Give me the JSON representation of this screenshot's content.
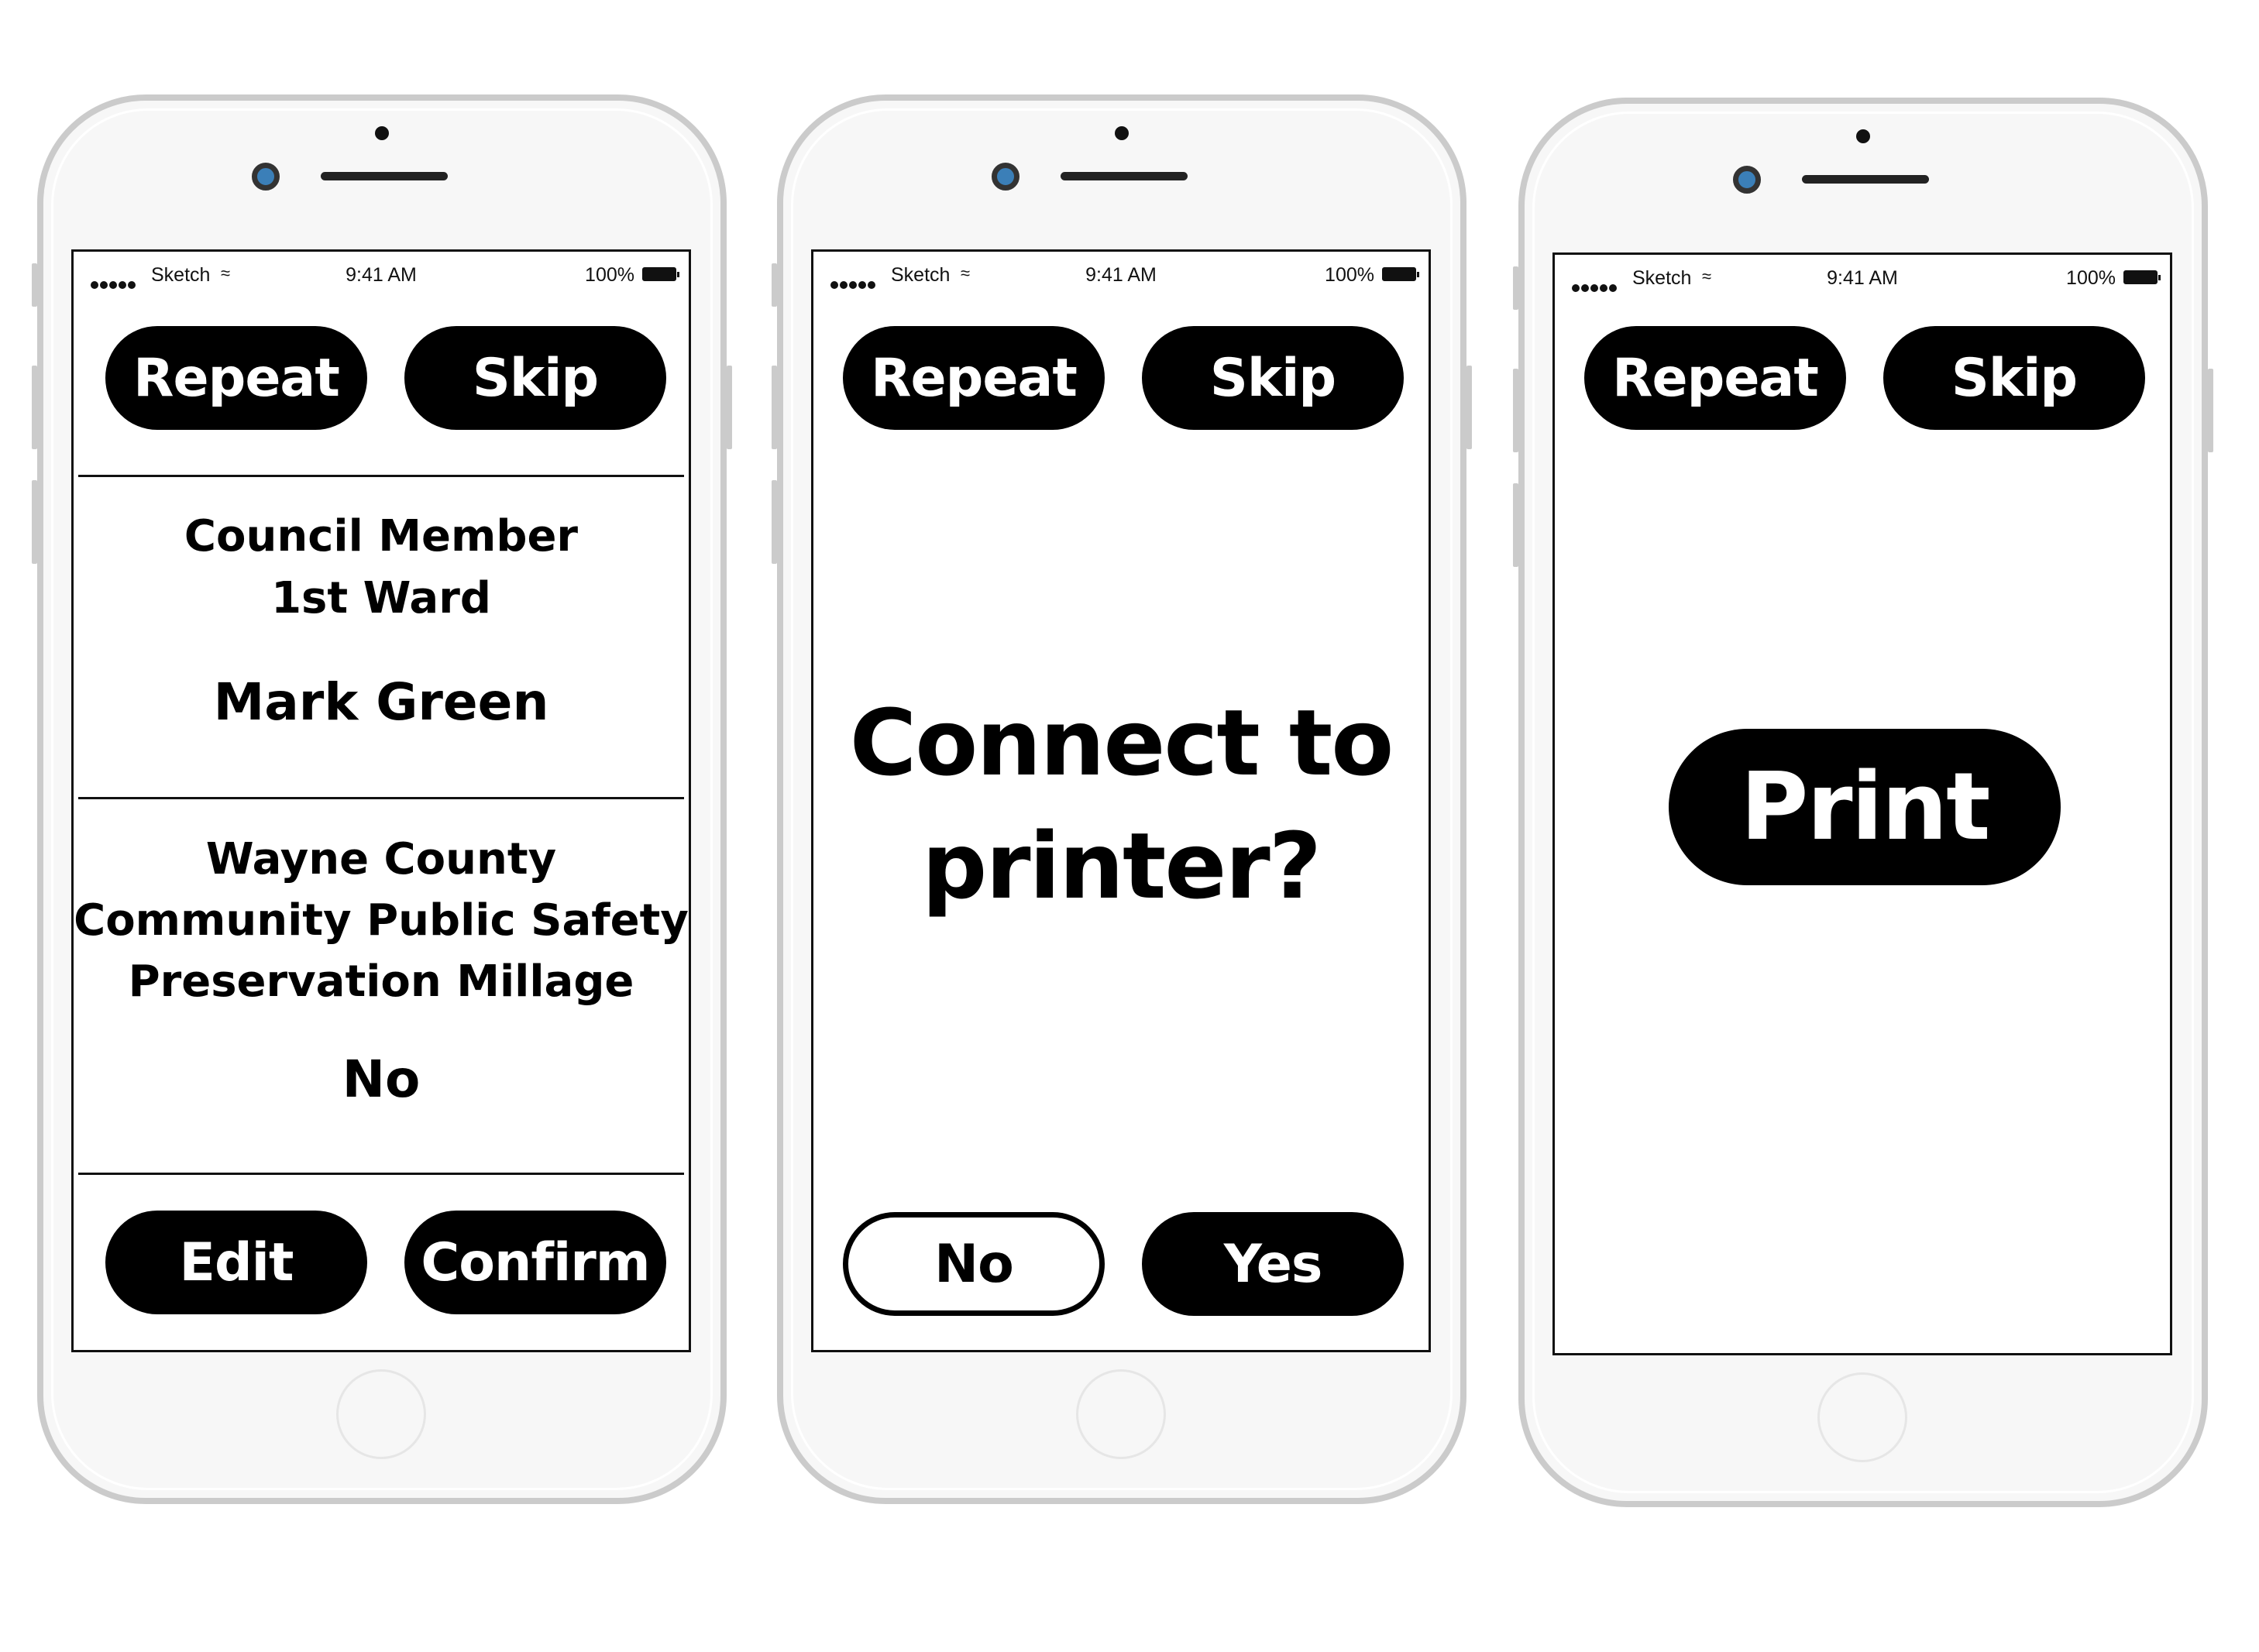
{
  "status_bar": {
    "carrier": "Sketch",
    "time": "9:41 AM",
    "battery": "100%"
  },
  "screens": [
    {
      "top_buttons": {
        "repeat": "Repeat",
        "skip": "Skip"
      },
      "race_1": {
        "title_line1": "Council Member",
        "title_line2": "1st Ward",
        "selection": "Mark Green"
      },
      "race_2": {
        "title_line1": "Wayne County",
        "title_line2": "Community Public Safety",
        "title_line3": "Preservation Millage",
        "selection": "No"
      },
      "bottom_buttons": {
        "edit": "Edit",
        "confirm": "Confirm"
      }
    },
    {
      "top_buttons": {
        "repeat": "Repeat",
        "skip": "Skip"
      },
      "prompt_line1": "Connect to",
      "prompt_line2": "printer?",
      "bottom_buttons": {
        "no": "No",
        "yes": "Yes"
      }
    },
    {
      "top_buttons": {
        "repeat": "Repeat",
        "skip": "Skip"
      },
      "print_button": "Print"
    }
  ]
}
